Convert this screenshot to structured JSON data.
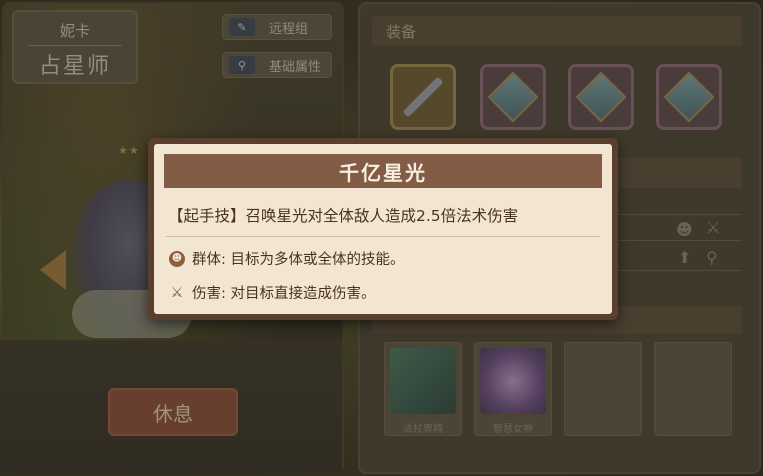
{
  "character": {
    "nickname": "妮卡",
    "job": "占星师",
    "tag_ranged": "远程组",
    "tag_stats": "基础属性",
    "rest_button": "休息",
    "stars": "★★"
  },
  "equipment": {
    "section_title": "装备",
    "slots": [
      {
        "name": "staff",
        "icon": "staff-icon"
      },
      {
        "name": "gem",
        "icon": "gem-icon"
      },
      {
        "name": "gem",
        "icon": "gem-icon"
      },
      {
        "name": "gem",
        "icon": "gem-icon"
      }
    ]
  },
  "skills": {
    "items": [
      {
        "label": "法杖專精",
        "icon": "wand-skill-icon"
      },
      {
        "label": "智慧女神",
        "icon": "goddess-skill-icon"
      },
      {
        "label": "",
        "icon": ""
      },
      {
        "label": "",
        "icon": ""
      }
    ]
  },
  "tooltip": {
    "title": "千亿星光",
    "description": "【起手技】召唤星光对全体敌人造成2.5倍法术伤害",
    "tags": [
      {
        "icon": "group-target-icon",
        "text": "群体: 目标为多体或全体的技能。"
      },
      {
        "icon": "sword-icon",
        "text": "伤害: 对目标直接造成伤害。"
      }
    ]
  },
  "colors": {
    "tooltip_frame": "#5a3e2e",
    "tooltip_bg": "#f2e6d3",
    "title_bar": "#835c45"
  }
}
